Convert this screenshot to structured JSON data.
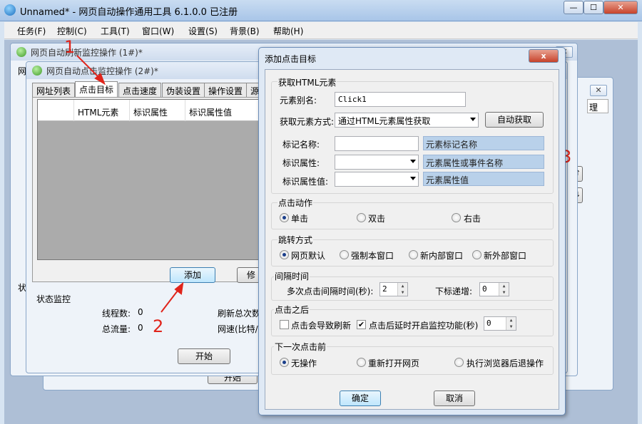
{
  "app": {
    "title": "Unnamed* - 网页自动操作通用工具 6.1.0.0 已注册"
  },
  "menu": [
    "任务(F)",
    "控制(C)",
    "工具(T)",
    "窗口(W)",
    "设置(S)",
    "背景(B)",
    "帮助(H)"
  ],
  "window1": {
    "title": "网页自动刷新监控操作 (1#)*"
  },
  "window2": {
    "title": "网页自动点击监控操作 (2#)*",
    "tabs": [
      "网址列表",
      "点击目标",
      "点击速度",
      "伪装设置",
      "操作设置",
      "源"
    ],
    "columns": [
      "HTML元素",
      "标识属性",
      "标识属性值"
    ],
    "add_label": "添加",
    "modify_label": "修",
    "status": {
      "header": "状态监控",
      "threads_label": "线程数:",
      "threads_value": "0",
      "traffic_label": "总流量:",
      "traffic_value": "0",
      "refresh_label": "刷新总次数",
      "speed_label": "网速(比特/"
    },
    "start_label": "开始",
    "bottom_start_label": "开始"
  },
  "annotations": {
    "a1": "1",
    "a2": "2",
    "a3": "3"
  },
  "dialog": {
    "title": "添加点击目标",
    "close": "x",
    "get_html": {
      "header": "获取HTML元素",
      "alias_label": "元素别名:",
      "alias_value": "Click1",
      "method_label": "获取元素方式:",
      "method_value": "通过HTML元素属性获取",
      "auto_get_label": "自动获取",
      "tag_label": "标记名称:",
      "tag_hint": "元素标记名称",
      "attr_label": "标识属性:",
      "attr_hint": "元素属性或事件名称",
      "attrval_label": "标识属性值:",
      "attrval_hint": "元素属性值"
    },
    "click_action": {
      "header": "点击动作",
      "options": [
        "单击",
        "双击",
        "右击"
      ],
      "selected": 0
    },
    "jump": {
      "header": "跳转方式",
      "options": [
        "网页默认",
        "强制本窗口",
        "新内部窗口",
        "新外部窗口"
      ],
      "selected": 0
    },
    "interval": {
      "header": "间隔时间",
      "multi_label": "多次点击间隔时间(秒):",
      "multi_value": "2",
      "index_label": "下标递增:",
      "index_value": "0"
    },
    "after_click": {
      "header": "点击之后",
      "refresh_label": "点击会导致刷新",
      "refresh_checked": false,
      "delay_label": "点击后延时开启监控功能(秒)",
      "delay_checked": true,
      "delay_value": "0"
    },
    "before_next": {
      "header": "下一次点击前",
      "options": [
        "无操作",
        "重新打开网页",
        "执行浏览器后退操作"
      ],
      "selected": 0
    },
    "ok_label": "确定",
    "cancel_label": "取消"
  }
}
